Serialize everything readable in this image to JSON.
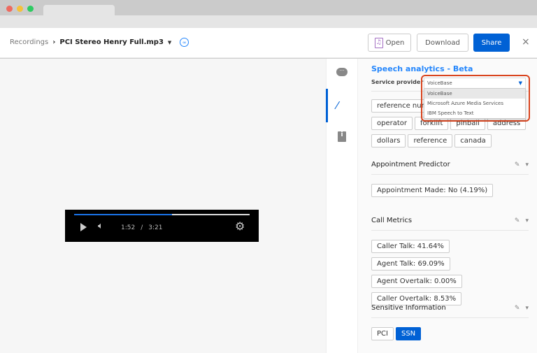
{
  "window": {
    "controls": [
      "#ee6a5f",
      "#f5c13b",
      "#2ecb62"
    ]
  },
  "header": {
    "breadcrumb_root": "Recordings",
    "separator": "›",
    "file_name": "PCI Stereo Henry Full.mp3",
    "open_label": "Open",
    "download_label": "Download",
    "share_label": "Share",
    "close": "×",
    "accent": "#0061d5"
  },
  "player": {
    "current_time": "1:52",
    "separator": "/",
    "duration": "3:21",
    "progress_percent": 55.7
  },
  "rail": {
    "items": [
      {
        "icon": "comment-icon",
        "active": false
      },
      {
        "icon": "magic-wand-icon",
        "active": true
      },
      {
        "icon": "file-info-icon",
        "active": false
      }
    ]
  },
  "panel": {
    "title": "Speech analytics - Beta",
    "provider_label": "Service provider",
    "provider_value": "VoiceBase",
    "provider_options": [
      "VoiceBase",
      "Microsoft Azure Media Services",
      "IBM Speech to Text"
    ],
    "keywords": [
      "reference num",
      "operator",
      "forklift",
      "pinball",
      "address",
      "dollars",
      "reference",
      "canada"
    ],
    "sections": [
      {
        "title": "Appointment Predictor",
        "tags": [
          "Appointment Made: No (4.19%)"
        ]
      },
      {
        "title": "Call Metrics",
        "tags": [
          "Caller Talk: 41.64%",
          "Agent Talk: 69.09%",
          "Agent Overtalk: 0.00%",
          "Caller Overtalk: 8.53%"
        ]
      },
      {
        "title": "Sensitive Information",
        "tags": [
          "PCI",
          "SSN"
        ],
        "selected": "SSN"
      }
    ]
  }
}
